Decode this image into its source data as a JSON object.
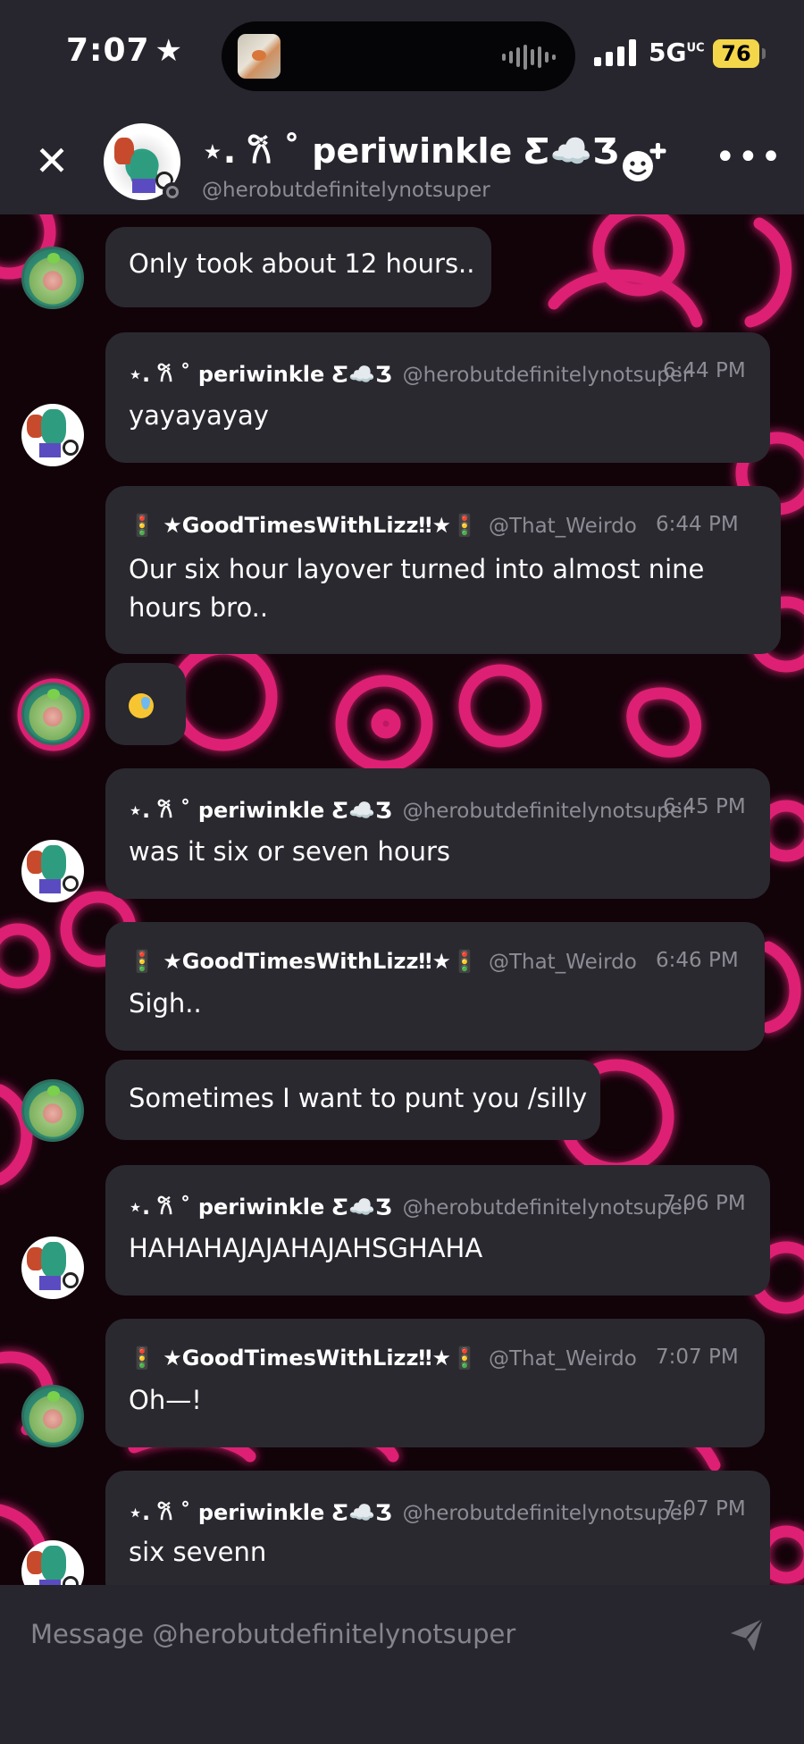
{
  "status_bar": {
    "time": "7:07",
    "time_star": "★",
    "network": "5G",
    "network_sup": "UC",
    "battery": "76"
  },
  "header": {
    "close_glyph": "✕",
    "name": "⋆. 𐙚 ˚ periwinkle Ƹ☁️Ʒ",
    "handle": "@herobutdefinitelynotsuper",
    "more_glyph": "•••"
  },
  "messages": [
    {
      "author": "",
      "handle": "",
      "time": "",
      "text": "Only took about 12 hours.."
    },
    {
      "author": "⋆. 𐙚 ˚ periwinkle Ƹ☁️Ʒ",
      "handle": "@herobutdefinitelynotsuper",
      "time": "6:44 PM",
      "text": "yayayayay"
    },
    {
      "author": "🚦 ★GoodTimesWithLizz‼★🚦",
      "handle": "@That_Weirdo",
      "time": "6:44 PM",
      "text": "Our six hour layover turned into almost nine",
      "text2": "hours bro.."
    },
    {
      "author": "",
      "handle": "",
      "time": "",
      "text": "😓"
    },
    {
      "author": "⋆. 𐙚 ˚ periwinkle Ƹ☁️Ʒ",
      "handle": "@herobutdefinitelynotsuper",
      "time": "6:45 PM",
      "text": "was it six or seven hours"
    },
    {
      "author": "🚦 ★GoodTimesWithLizz‼★🚦",
      "handle": "@That_Weirdo",
      "time": "6:46 PM",
      "text": "Sigh.."
    },
    {
      "author": "",
      "handle": "",
      "time": "",
      "text": "Sometimes I want to punt you /silly"
    },
    {
      "author": "⋆. 𐙚 ˚ periwinkle Ƹ☁️Ʒ",
      "handle": "@herobutdefinitelynotsuper",
      "time": "7:06 PM",
      "text": "HAHAHAJAJAHAJAHSGHAHA"
    },
    {
      "author": "🚦 ★GoodTimesWithLizz‼★🚦",
      "handle": "@That_Weirdo",
      "time": "7:07 PM",
      "text": "Oh—!"
    },
    {
      "author": "⋆. 𐙚 ˚ periwinkle Ƹ☁️Ʒ",
      "handle": "@herobutdefinitelynotsuper",
      "time": "7:07 PM",
      "text": "six sevenn"
    }
  ],
  "composer": {
    "placeholder": "Message @herobutdefinitelynotsuper"
  },
  "icons": {
    "close": "close-icon",
    "add_friend": "add-friend-icon",
    "more": "more-icon",
    "send": "send-icon"
  },
  "colors": {
    "background": "#27262e",
    "bubble": "#2a2930",
    "wallpaper_base": "#120309",
    "wallpaper_accent": "#e8237a",
    "muted_text": "#8d8b94",
    "battery": "#f4d64a"
  }
}
